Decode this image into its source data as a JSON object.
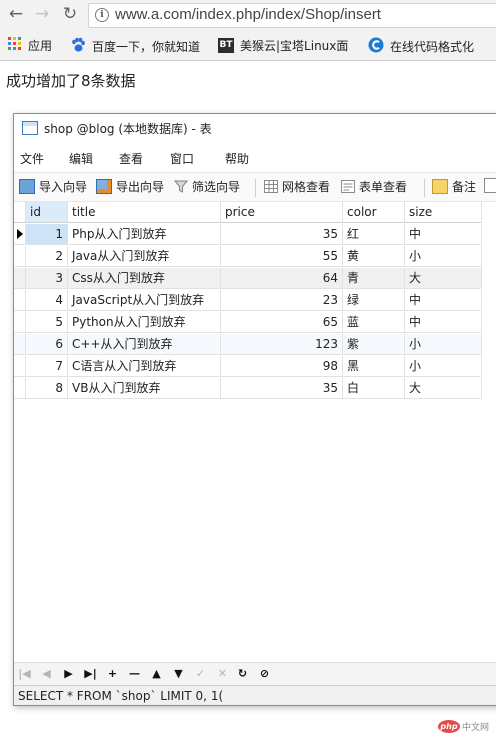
{
  "browser": {
    "url": "www.a.com/index.php/index/Shop/insert",
    "bookmarks": [
      {
        "label": "应用"
      },
      {
        "label": "百度一下，你就知道"
      },
      {
        "label": "美猴云|宝塔Linux面"
      },
      {
        "label": "在线代码格式化"
      }
    ],
    "bt_badge": "BT"
  },
  "page": {
    "message": "成功增加了8条数据"
  },
  "window": {
    "title": "shop @blog (本地数据库) - 表",
    "menu": [
      "文件",
      "编辑",
      "查看",
      "窗口",
      "帮助"
    ],
    "toolbar": [
      "导入向导",
      "导出向导",
      "筛选向导",
      "网格查看",
      "表单查看",
      "备注"
    ]
  },
  "table": {
    "columns": [
      "id",
      "title",
      "price",
      "color",
      "size"
    ],
    "rows": [
      {
        "id": "1",
        "title": "Php从入门到放弃",
        "price": "35",
        "color": "红",
        "size": "中"
      },
      {
        "id": "2",
        "title": "Java从入门到放弃",
        "price": "55",
        "color": "黄",
        "size": "小"
      },
      {
        "id": "3",
        "title": "Css从入门到放弃",
        "price": "64",
        "color": "青",
        "size": "大"
      },
      {
        "id": "4",
        "title": "JavaScript从入门到放弃",
        "price": "23",
        "color": "绿",
        "size": "中"
      },
      {
        "id": "5",
        "title": "Python从入门到放弃",
        "price": "65",
        "color": "蓝",
        "size": "中"
      },
      {
        "id": "6",
        "title": "C++从入门到放弃",
        "price": "123",
        "color": "紫",
        "size": "小"
      },
      {
        "id": "7",
        "title": "C语言从入门到放弃",
        "price": "98",
        "color": "黑",
        "size": "小"
      },
      {
        "id": "8",
        "title": "VB从入门到放弃",
        "price": "35",
        "color": "白",
        "size": "大"
      }
    ]
  },
  "statusbar": {
    "query": "SELECT * FROM `shop` LIMIT 0, 1("
  },
  "watermark": {
    "logo": "php",
    "site": "中文网"
  }
}
